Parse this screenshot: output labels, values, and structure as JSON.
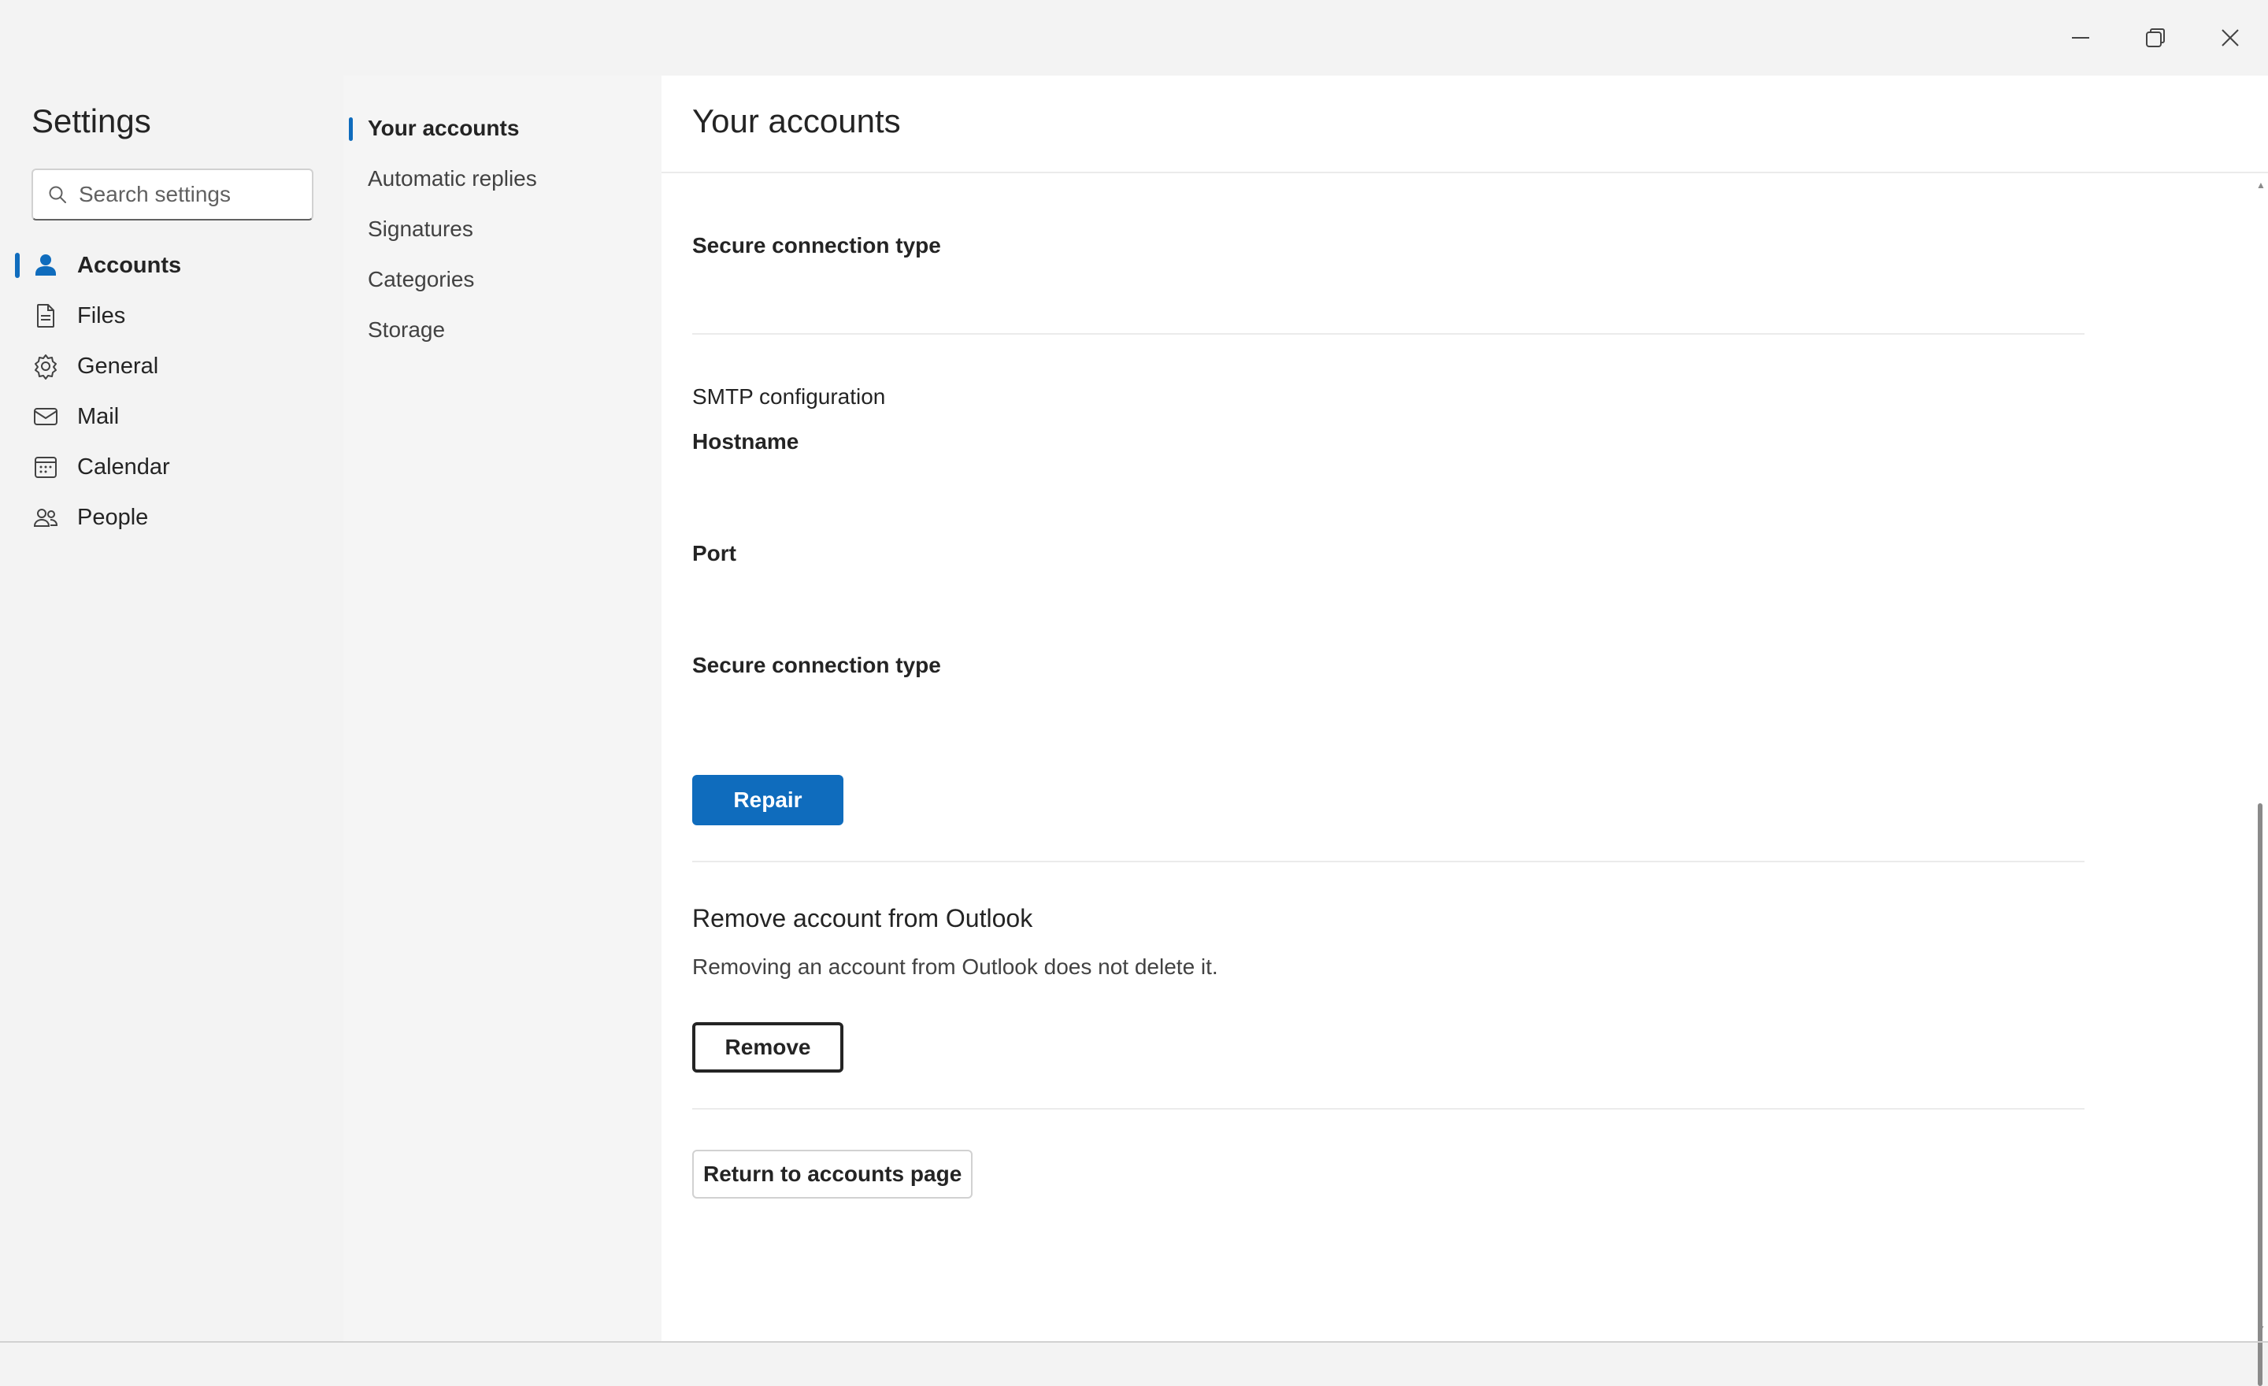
{
  "window": {
    "controls": [
      {
        "name": "minimize-icon",
        "symbol": "minimize"
      },
      {
        "name": "restore-icon",
        "symbol": "restore"
      },
      {
        "name": "close-icon",
        "symbol": "close"
      }
    ]
  },
  "sidebar": {
    "title": "Settings",
    "search_placeholder": "Search settings",
    "items": [
      {
        "label": "Accounts",
        "icon": "person-icon",
        "active": true
      },
      {
        "label": "Files",
        "icon": "file-icon",
        "active": false
      },
      {
        "label": "General",
        "icon": "gear-icon",
        "active": false
      },
      {
        "label": "Mail",
        "icon": "mail-icon",
        "active": false
      },
      {
        "label": "Calendar",
        "icon": "calendar-icon",
        "active": false
      },
      {
        "label": "People",
        "icon": "people-icon",
        "active": false
      }
    ]
  },
  "subnav": {
    "items": [
      {
        "label": "Your accounts",
        "active": true
      },
      {
        "label": "Automatic replies",
        "active": false
      },
      {
        "label": "Signatures",
        "active": false
      },
      {
        "label": "Categories",
        "active": false
      },
      {
        "label": "Storage",
        "active": false
      }
    ]
  },
  "main": {
    "title": "Your accounts",
    "secure_connection_label_1": "Secure connection type",
    "smtp_heading": "SMTP configuration",
    "hostname_label": "Hostname",
    "port_label": "Port",
    "secure_connection_label_2": "Secure connection type",
    "repair_button": "Repair",
    "remove_section_title": "Remove account from Outlook",
    "remove_section_desc": "Removing an account from Outlook does not delete it.",
    "remove_button": "Remove",
    "return_button": "Return to accounts page"
  },
  "colors": {
    "accent": "#0f6cbd",
    "background": "#f3f3f3",
    "content_background": "#ffffff"
  }
}
